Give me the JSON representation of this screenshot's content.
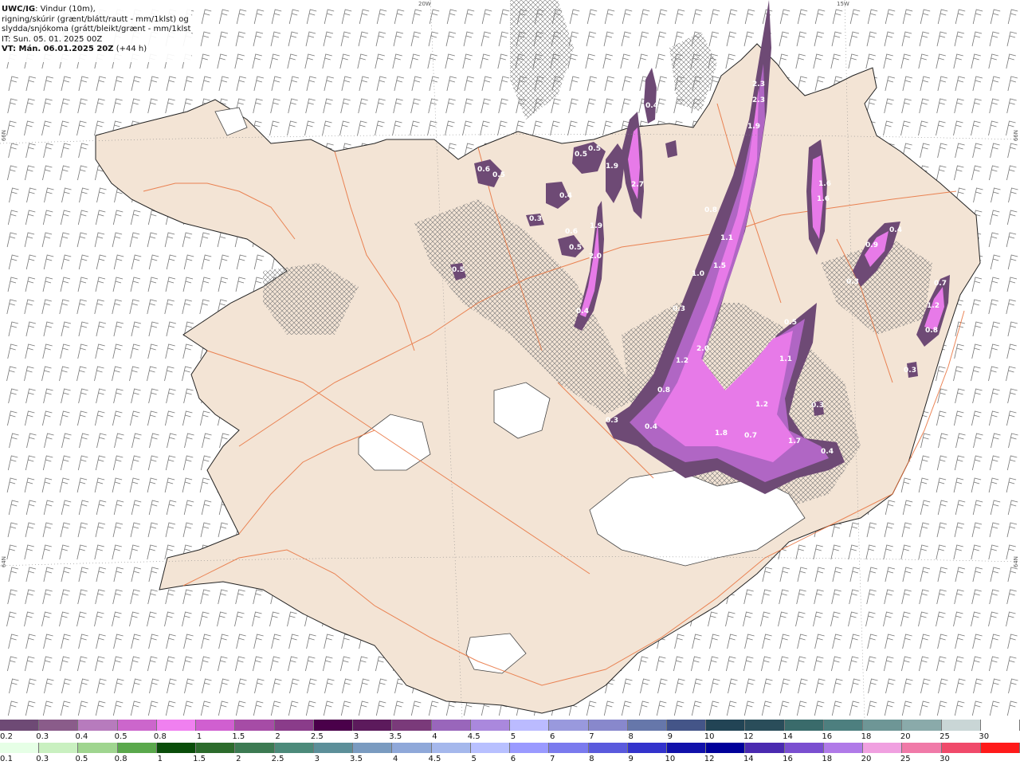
{
  "header": {
    "model": "UWC/IG",
    "line1_rest": ": Vindur (10m),",
    "line2": "rigning/skúrir (grænt/blátt/rautt - mm/1klst) og",
    "line3": "slydda/snjókoma (grátt/bleikt/grænt - mm/1klst)",
    "line4": "IT: Sun. 05. 01. 2025 00Z",
    "line5": "VT: Mán. 06.01.2025 20Z",
    "line5_rest": " (+44 h)"
  },
  "axis_labels": {
    "top_left": "20W",
    "top_right": "15W",
    "left_upper": "66N",
    "left_lower": "64N",
    "right_upper": "66N",
    "right_lower": "64N"
  },
  "colors": {
    "land": "#f3e4d5",
    "roads": "#e8703a",
    "glacier": "#ffffff",
    "precip_dark": "#6e4a75",
    "precip_mid": "#b066c4",
    "precip_light": "#e77ae8"
  },
  "precip_labels": [
    "0.5",
    "2.3",
    "2.3",
    "1.9",
    "0.4",
    "0.5",
    "0.5",
    "0.6",
    "0.5",
    "1.9",
    "2.7",
    "0.4",
    "1.6",
    "1.6",
    "0.4",
    "0.9",
    "0.3",
    "0.7",
    "1.2",
    "0.8",
    "0.8",
    "1.1",
    "1.5",
    "1.0",
    "1.9",
    "2.0",
    "0.4",
    "0.6",
    "0.3",
    "0.5",
    "1.2",
    "0.8",
    "2.0",
    "0.3",
    "0.4",
    "0.5",
    "1.1",
    "1.2",
    "1.8",
    "0.7",
    "1.7",
    "0.4",
    "0.3",
    "0.3",
    "0.3",
    "0.1"
  ],
  "legend": {
    "snow": {
      "colors": [
        "#6e4a75",
        "#8a5c8a",
        "#b77bbd",
        "#cc66cc",
        "#f080f0",
        "#d05fd0",
        "#a64ca6",
        "#8a3c8a",
        "#4a004a",
        "#5c1a5c",
        "#7a3a7a",
        "#9966bb",
        "#aa88dd",
        "#bbbbff",
        "#9999dd",
        "#8888cc",
        "#6677aa",
        "#445588",
        "#224455",
        "#2a4d5a",
        "#3a6b6b",
        "#4d7f7f",
        "#6e9696",
        "#8aaaaa",
        "#c9d6d6",
        "#ffffff"
      ],
      "labels": [
        "0.2",
        "0.3",
        "0.4",
        "0.5",
        "0.8",
        "1",
        "1.5",
        "2",
        "2.5",
        "3",
        "3.5",
        "4",
        "4.5",
        "5",
        "6",
        "7",
        "8",
        "9",
        "10",
        "12",
        "14",
        "16",
        "18",
        "20",
        "25",
        "30"
      ]
    },
    "rain": {
      "colors": [
        "#e6ffe6",
        "#c9f0c0",
        "#9fd58f",
        "#5aa84c",
        "#0a4d0a",
        "#2c6b2c",
        "#3c7a52",
        "#4c8a7a",
        "#5c8f99",
        "#7a9bc0",
        "#8fa8d9",
        "#a5b8ec",
        "#b8c0ff",
        "#9a9aff",
        "#7a7aee",
        "#5a5add",
        "#3333cc",
        "#1111aa",
        "#00009a",
        "#4a2ab0",
        "#7a4fd0",
        "#b07ae8",
        "#f0a0e0",
        "#f07aa8",
        "#f04a6a",
        "#ff1a1a"
      ],
      "labels": [
        "0.1",
        "0.3",
        "0.5",
        "0.8",
        "1",
        "1.5",
        "2",
        "2.5",
        "3",
        "3.5",
        "4",
        "4.5",
        "5",
        "6",
        "7",
        "8",
        "9",
        "10",
        "12",
        "14",
        "16",
        "18",
        "20",
        "25",
        "30"
      ]
    }
  }
}
